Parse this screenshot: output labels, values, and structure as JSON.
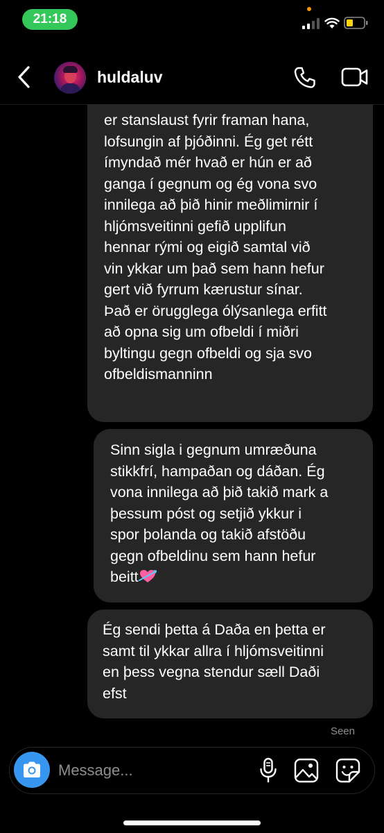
{
  "status_bar": {
    "time": "21:18"
  },
  "header": {
    "username": "huldaluv"
  },
  "messages": [
    {
      "lines": [
        "er stanslaust fyrir framan hana,",
        "lofsungin af þjóðinni. Ég get rétt",
        "ímyndað mér hvað er hún er að",
        "ganga í gegnum og ég vona svo",
        "innilega að þið hinir meðlimirnir í",
        "hljómsveitinni gefið upplifun",
        "hennar rými og eigið samtal við",
        "vin ykkar um það sem hann hefur",
        "gert við fyrrum kærustur sínar.",
        "Það er örugglega ólýsanlega erfitt",
        "að opna sig um ofbeldi í miðri",
        "byltingu gegn ofbeldi og sja svo",
        "ofbeldismanninn"
      ]
    },
    {
      "lines": [
        "Sinn sigla i gegnum umræðuna",
        "stikkfrí, hampaðan og dáðan. Ég",
        "vona innilega að þið takið mark a",
        "þessum póst og setjið ykkur i",
        "spor þolanda og takið afstöðu",
        "gegn ofbeldinu sem hann hefur",
        "beitt"
      ],
      "emoji": "heart-with-arrow-emoji"
    },
    {
      "lines": [
        "Ég sendi þetta á Daða en þetta er",
        "samt til ykkar allra í hljómsveitinni",
        "en þess vegna stendur sæll Daði",
        "efst"
      ]
    }
  ],
  "seen_label": "Seen",
  "composer": {
    "placeholder": "Message..."
  },
  "colors": {
    "background": "#000000",
    "bubble": "#262626",
    "camera_button": "#3797f0",
    "time_pill": "#34c759",
    "muted_text": "#8e8e8e"
  },
  "icons": [
    "back-icon",
    "phone-icon",
    "video-icon",
    "camera-icon",
    "mic-icon",
    "gallery-icon",
    "sticker-icon"
  ]
}
